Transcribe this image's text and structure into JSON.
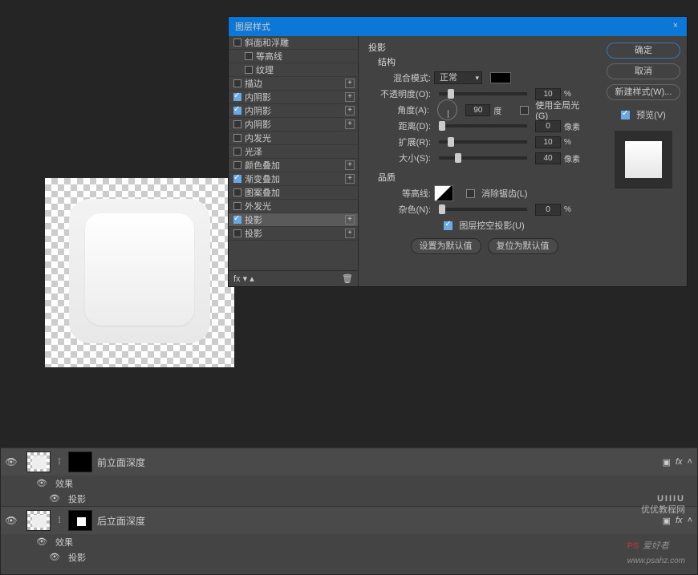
{
  "dialog": {
    "title": "图层样式",
    "close_label": "×",
    "styles": [
      {
        "label": "斜面和浮雕",
        "checked": false,
        "plus": false,
        "indent": false
      },
      {
        "label": "等高线",
        "checked": false,
        "plus": false,
        "indent": true
      },
      {
        "label": "纹理",
        "checked": false,
        "plus": false,
        "indent": true
      },
      {
        "label": "描边",
        "checked": false,
        "plus": true,
        "indent": false
      },
      {
        "label": "内阴影",
        "checked": true,
        "plus": true,
        "indent": false
      },
      {
        "label": "内阴影",
        "checked": true,
        "plus": true,
        "indent": false
      },
      {
        "label": "内阴影",
        "checked": false,
        "plus": true,
        "indent": false
      },
      {
        "label": "内发光",
        "checked": false,
        "plus": false,
        "indent": false
      },
      {
        "label": "光泽",
        "checked": false,
        "plus": false,
        "indent": false
      },
      {
        "label": "颜色叠加",
        "checked": false,
        "plus": true,
        "indent": false
      },
      {
        "label": "渐变叠加",
        "checked": true,
        "plus": true,
        "indent": false
      },
      {
        "label": "图案叠加",
        "checked": false,
        "plus": false,
        "indent": false
      },
      {
        "label": "外发光",
        "checked": false,
        "plus": false,
        "indent": false
      },
      {
        "label": "投影",
        "checked": true,
        "plus": true,
        "indent": false,
        "selected": true
      },
      {
        "label": "投影",
        "checked": false,
        "plus": true,
        "indent": false
      }
    ],
    "footer_fx": "fx",
    "section_drop": "投影",
    "section_structure": "结构",
    "blend_mode_label": "混合模式:",
    "blend_mode_value": "正常",
    "opacity_label": "不透明度(O):",
    "opacity_value": "10",
    "opacity_unit": "%",
    "angle_label": "角度(A):",
    "angle_value": "90",
    "angle_unit": "度",
    "use_global": "使用全局光(G)",
    "distance_label": "距离(D):",
    "distance_value": "0",
    "distance_unit": "像素",
    "spread_label": "扩展(R):",
    "spread_value": "10",
    "spread_unit": "%",
    "size_label": "大小(S):",
    "size_value": "40",
    "size_unit": "像素",
    "section_quality": "品质",
    "contour_label": "等高线:",
    "antialias_label": "消除锯齿(L)",
    "noise_label": "杂色(N):",
    "noise_value": "0",
    "noise_unit": "%",
    "knockout_label": "图层挖空投影(U)",
    "btn_default": "设置为默认值",
    "btn_reset": "复位为默认值",
    "btn_ok": "确定",
    "btn_cancel": "取消",
    "btn_new_style": "新建样式(W)...",
    "preview_label": "预览(V)"
  },
  "layers": [
    {
      "name": "前立面深度",
      "effects_label": "效果",
      "shadow_label": "投影",
      "fx": "fx",
      "mask_white": false
    },
    {
      "name": "后立面深度",
      "effects_label": "效果",
      "shadow_label": "投影",
      "fx": "fx",
      "mask_white": true
    }
  ],
  "watermark_cn": "优优教程网",
  "watermark_ps": "PS",
  "watermark_site": "爱好者",
  "watermark_url": "www.psahz.com"
}
